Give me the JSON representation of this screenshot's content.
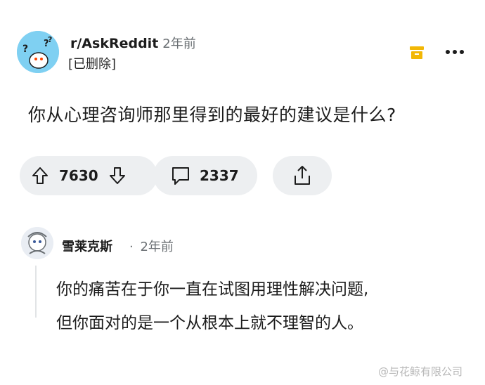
{
  "post": {
    "subreddit": "r/AskReddit",
    "age": "2年前",
    "author": "[已删除]",
    "title": "你从心理咨询师那里得到的最好的建议是什么?",
    "upvotes": "7630",
    "comments": "2337"
  },
  "comment": {
    "author": "雪莱克斯",
    "separator": "·",
    "age": "2年前",
    "lines": [
      "你的痛苦在于你一直在试图用理性解决问题,",
      "但你面对的是一个从根本上就不理智的人。"
    ]
  },
  "watermark": "@与花鲸有限公司",
  "colors": {
    "subreddit_avatar_bg": "#7fd0f2",
    "save_icon": "#f2b705",
    "pill_bg": "#edeff1",
    "thread_line": "#e2e4e6"
  },
  "icons": [
    "save-icon",
    "more-options-icon",
    "upvote-icon",
    "downvote-icon",
    "comment-icon",
    "share-icon"
  ]
}
